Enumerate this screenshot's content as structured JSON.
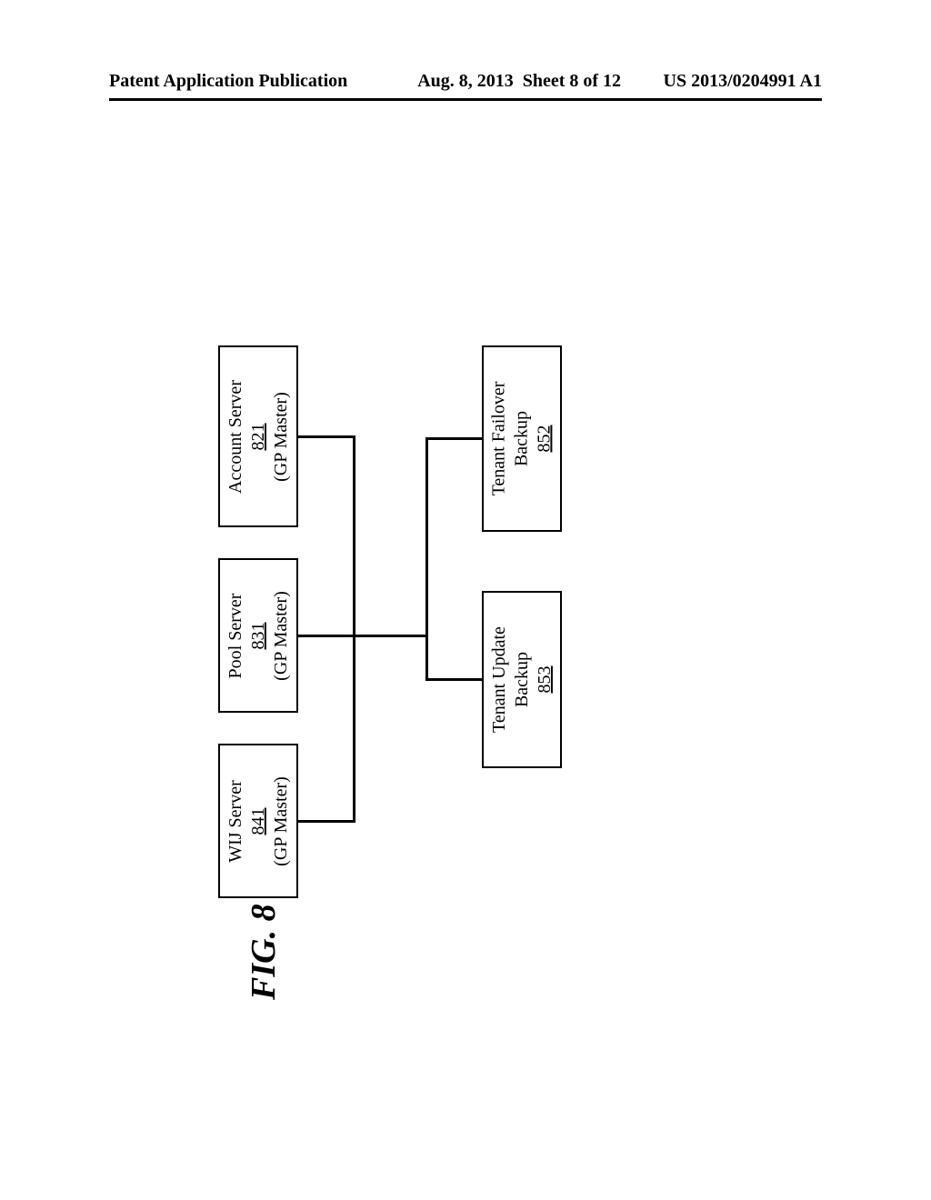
{
  "header": {
    "left": "Patent Application Publication",
    "date": "Aug. 8, 2013",
    "sheet": "Sheet 8 of 12",
    "pubno": "US 2013/0204991 A1"
  },
  "boxes": {
    "account": {
      "line1": "Account Server",
      "num": "821",
      "line3": "(GP Master)"
    },
    "pool": {
      "line1": "Pool Server",
      "num": "831",
      "line3": "(GP Master)"
    },
    "wij": {
      "line1": "WIJ Server",
      "num": "841",
      "line3": "(GP Master)"
    },
    "failover": {
      "line1": "Tenant Failover",
      "line2": "Backup",
      "num": "852"
    },
    "update": {
      "line1": "Tenant Update",
      "line2": "Backup",
      "num": "853"
    }
  },
  "figure_label": "FIG. 8"
}
